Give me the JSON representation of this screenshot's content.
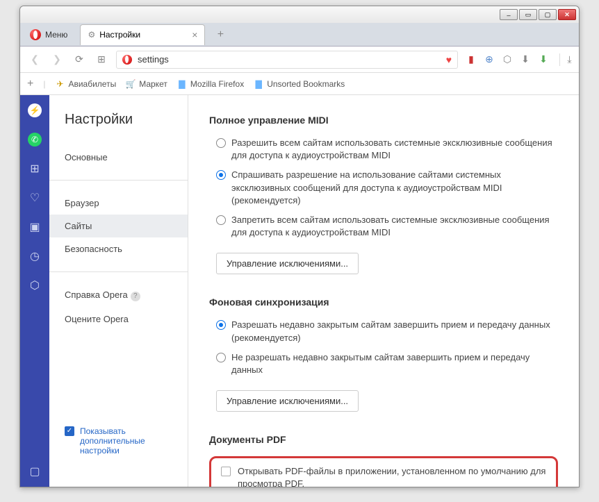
{
  "menu_label": "Меню",
  "tab": {
    "title": "Настройки"
  },
  "url": "settings",
  "bookmarks": {
    "items": [
      {
        "label": "Авиабилеты",
        "icon": "✈",
        "color": "#c90"
      },
      {
        "label": "Маркет",
        "icon": "🛒",
        "color": "#38c"
      },
      {
        "label": "Mozilla Firefox",
        "icon": "📁",
        "color": "#6bb6ff"
      },
      {
        "label": "Unsorted Bookmarks",
        "icon": "📁",
        "color": "#6bb6ff"
      }
    ]
  },
  "settings": {
    "title": "Настройки",
    "nav": {
      "basic": "Основные",
      "browser": "Браузер",
      "sites": "Сайты",
      "security": "Безопасность",
      "help": "Справка Opera",
      "rate": "Оцените Opera"
    },
    "show_advanced": "Показывать дополнительные настройки"
  },
  "midi": {
    "title": "Полное управление MIDI",
    "opt1": "Разрешить всем сайтам использовать системные эксклюзивные сообщения для доступа к аудиоустройствам MIDI",
    "opt2": "Спрашивать разрешение на использование сайтами системных эксклюзивных сообщений для доступа к аудиоустройствам MIDI (рекомендуется)",
    "opt3": "Запретить всем сайтам использовать системные эксклюзивные сообщения для доступа к аудиоустройствам MIDI",
    "exceptions": "Управление исключениями..."
  },
  "bgsync": {
    "title": "Фоновая синхронизация",
    "opt1": "Разрешать недавно закрытым сайтам завершить прием и передачу данных (рекомендуется)",
    "opt2": "Не разрешать недавно закрытым сайтам завершить прием и передачу данных",
    "exceptions": "Управление исключениями..."
  },
  "pdf": {
    "title": "Документы PDF",
    "label": "Открывать PDF-файлы в приложении, установленном по умолчанию для просмотра PDF."
  }
}
